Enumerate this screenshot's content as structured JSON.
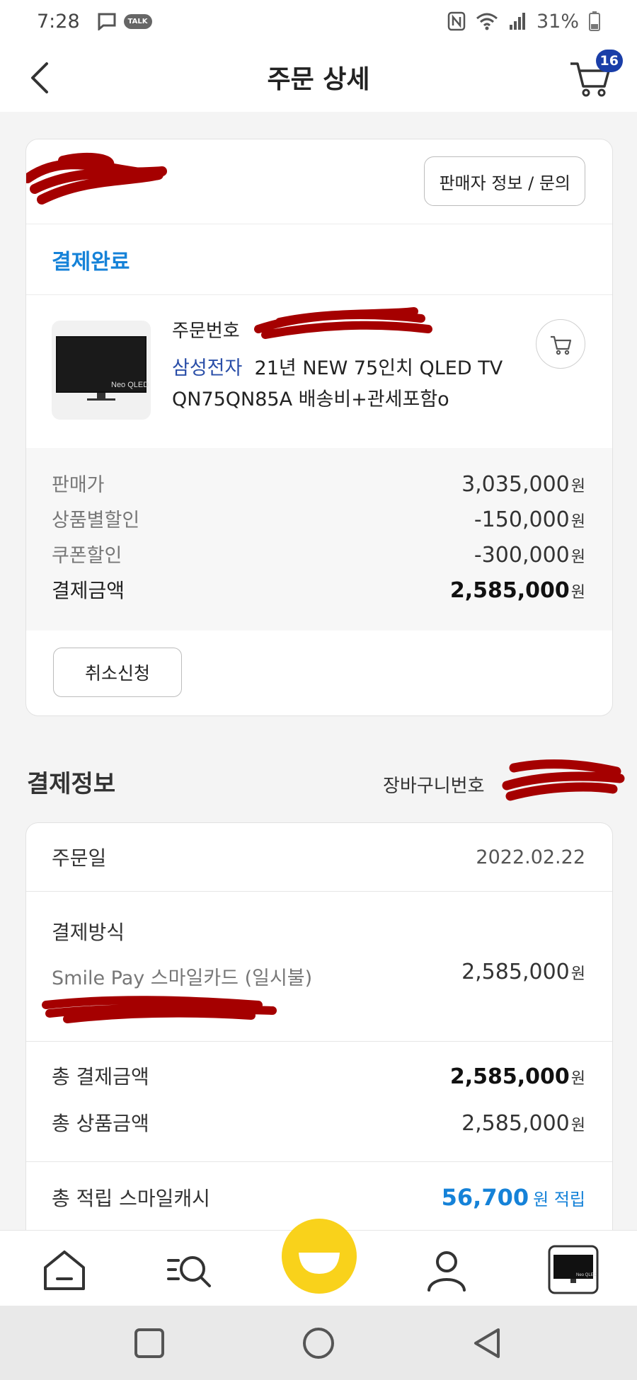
{
  "status_bar": {
    "time": "7:28",
    "talk": "TALK",
    "battery": "31%"
  },
  "header": {
    "title": "주문 상세",
    "cart_count": "16"
  },
  "order": {
    "seller_button": "판매자 정보 / 문의",
    "status": "결제완료",
    "order_no_label": "주문번호",
    "brand": "삼성전자",
    "product_name": "21년 NEW 75인치 QLED TV QN75QN85A 배송비+관세포함o",
    "thumb_text": "Neo QLED",
    "prices": [
      {
        "label": "판매가",
        "value": "3,035,000",
        "unit": "원"
      },
      {
        "label": "상품별할인",
        "value": "-150,000",
        "unit": "원"
      },
      {
        "label": "쿠폰할인",
        "value": "-300,000",
        "unit": "원"
      },
      {
        "label": "결제금액",
        "value": "2,585,000",
        "unit": "원"
      }
    ],
    "cancel_button": "취소신청"
  },
  "payment": {
    "section_title": "결제정보",
    "basket_label": "장바구니번호",
    "order_date_label": "주문일",
    "order_date": "2022.02.22",
    "method_label": "결제방식",
    "method_value": "Smile Pay 스마일카드 (일시불)",
    "method_amount": "2,585,000",
    "unit": "원",
    "total_pay_label": "총 결제금액",
    "total_pay": "2,585,000",
    "total_product_label": "총 상품금액",
    "total_product": "2,585,000",
    "cash_label": "총 적립 스마일캐시",
    "cash_value": "56,700",
    "cash_suffix": "원 적립"
  },
  "tab_bar": {
    "items": [
      "home-icon",
      "search-menu-icon",
      "smile-icon",
      "my-account-icon",
      "recent-product-icon"
    ]
  },
  "colors": {
    "accent": "#1582d8",
    "brand": "#2a4ea8",
    "smile": "#f9d21b",
    "badge": "#1a3ea8"
  }
}
